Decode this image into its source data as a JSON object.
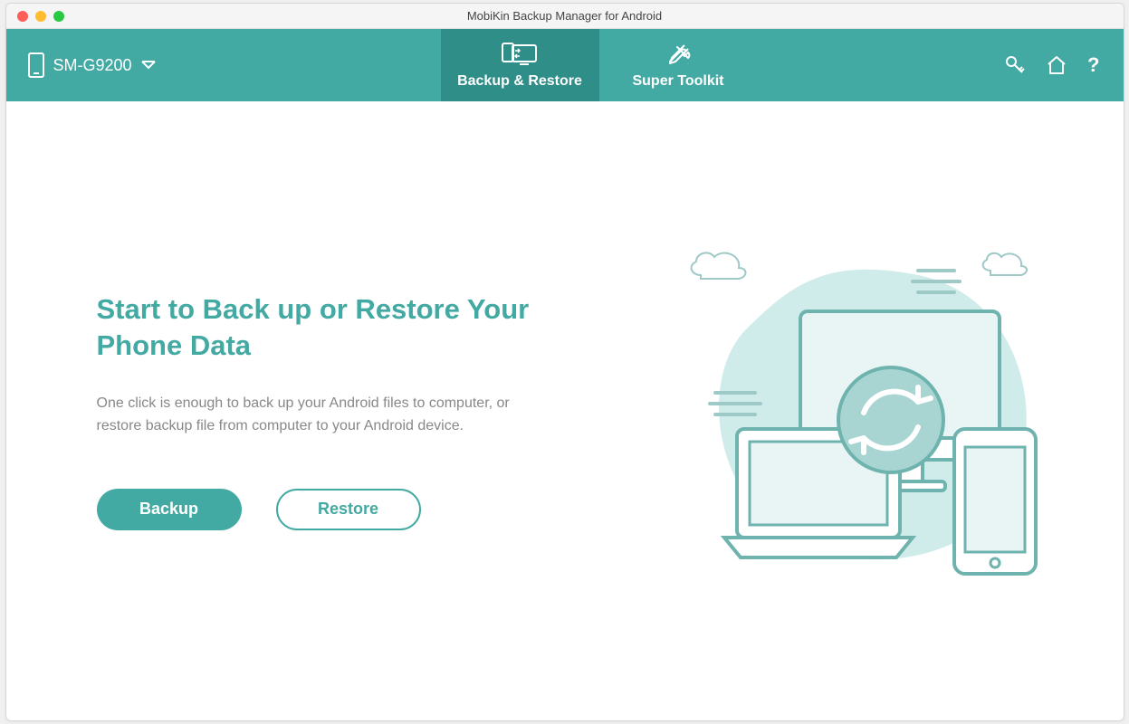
{
  "window": {
    "title": "MobiKin Backup Manager for Android"
  },
  "toolbar": {
    "device_name": "SM-G9200",
    "tabs": [
      {
        "label": "Backup & Restore",
        "active": true
      },
      {
        "label": "Super Toolkit",
        "active": false
      }
    ]
  },
  "main": {
    "headline": "Start to Back up or Restore Your Phone Data",
    "description": "One click is enough to back up your Android files to computer, or restore backup file from computer to your Android device.",
    "backup_label": "Backup",
    "restore_label": "Restore"
  },
  "colors": {
    "accent": "#43a9a3",
    "accent_dark": "#2f8e88",
    "text_muted": "#888888"
  }
}
